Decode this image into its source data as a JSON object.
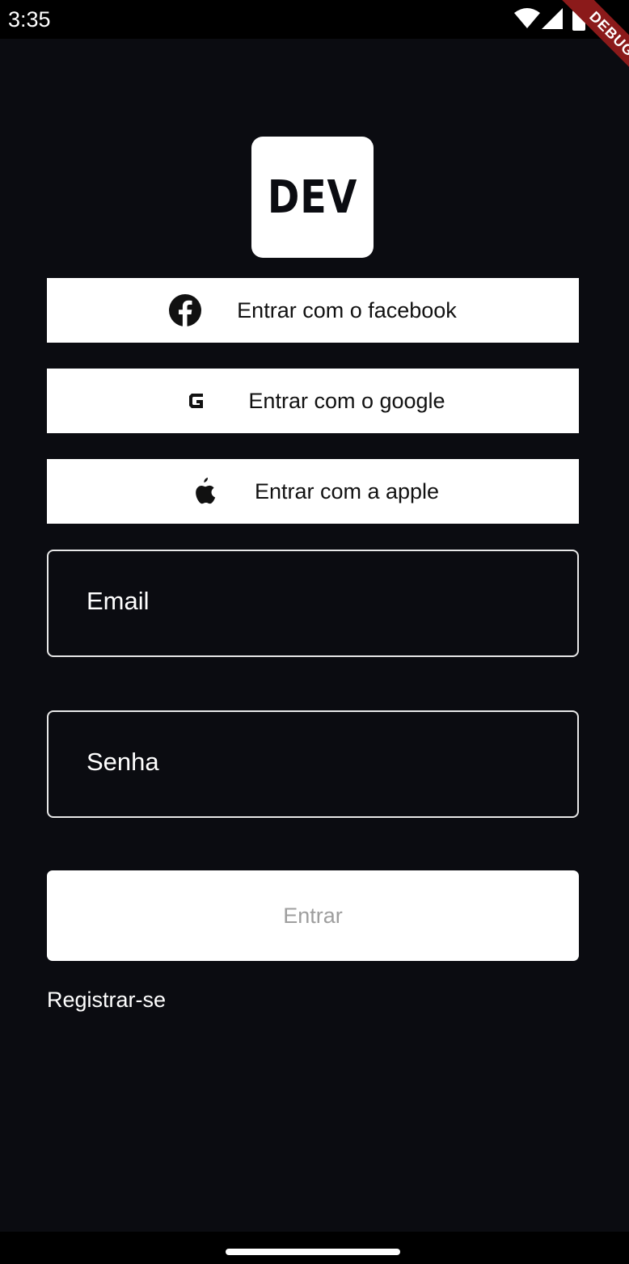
{
  "status_bar": {
    "time": "3:35",
    "icons": [
      "wifi-icon",
      "cellular-signal-icon",
      "battery-icon"
    ]
  },
  "debug_banner": {
    "label": "DEBUG",
    "color": "#8b1a1a"
  },
  "logo": {
    "text": "DEV"
  },
  "social_buttons": [
    {
      "label": "Entrar com o facebook",
      "icon": "facebook-icon"
    },
    {
      "label": "Entrar com o google",
      "icon": "google-icon"
    },
    {
      "label": "Entrar com a apple",
      "icon": "apple-icon"
    }
  ],
  "form": {
    "email_placeholder": "Email",
    "password_placeholder": "Senha",
    "submit_label": "Entrar",
    "register_label": "Registrar-se"
  },
  "colors": {
    "background": "#0b0c11",
    "button_background": "#ffffff",
    "button_text": "#111111",
    "submit_text_disabled": "#9e9e9e",
    "input_border": "#e8e8e8"
  }
}
